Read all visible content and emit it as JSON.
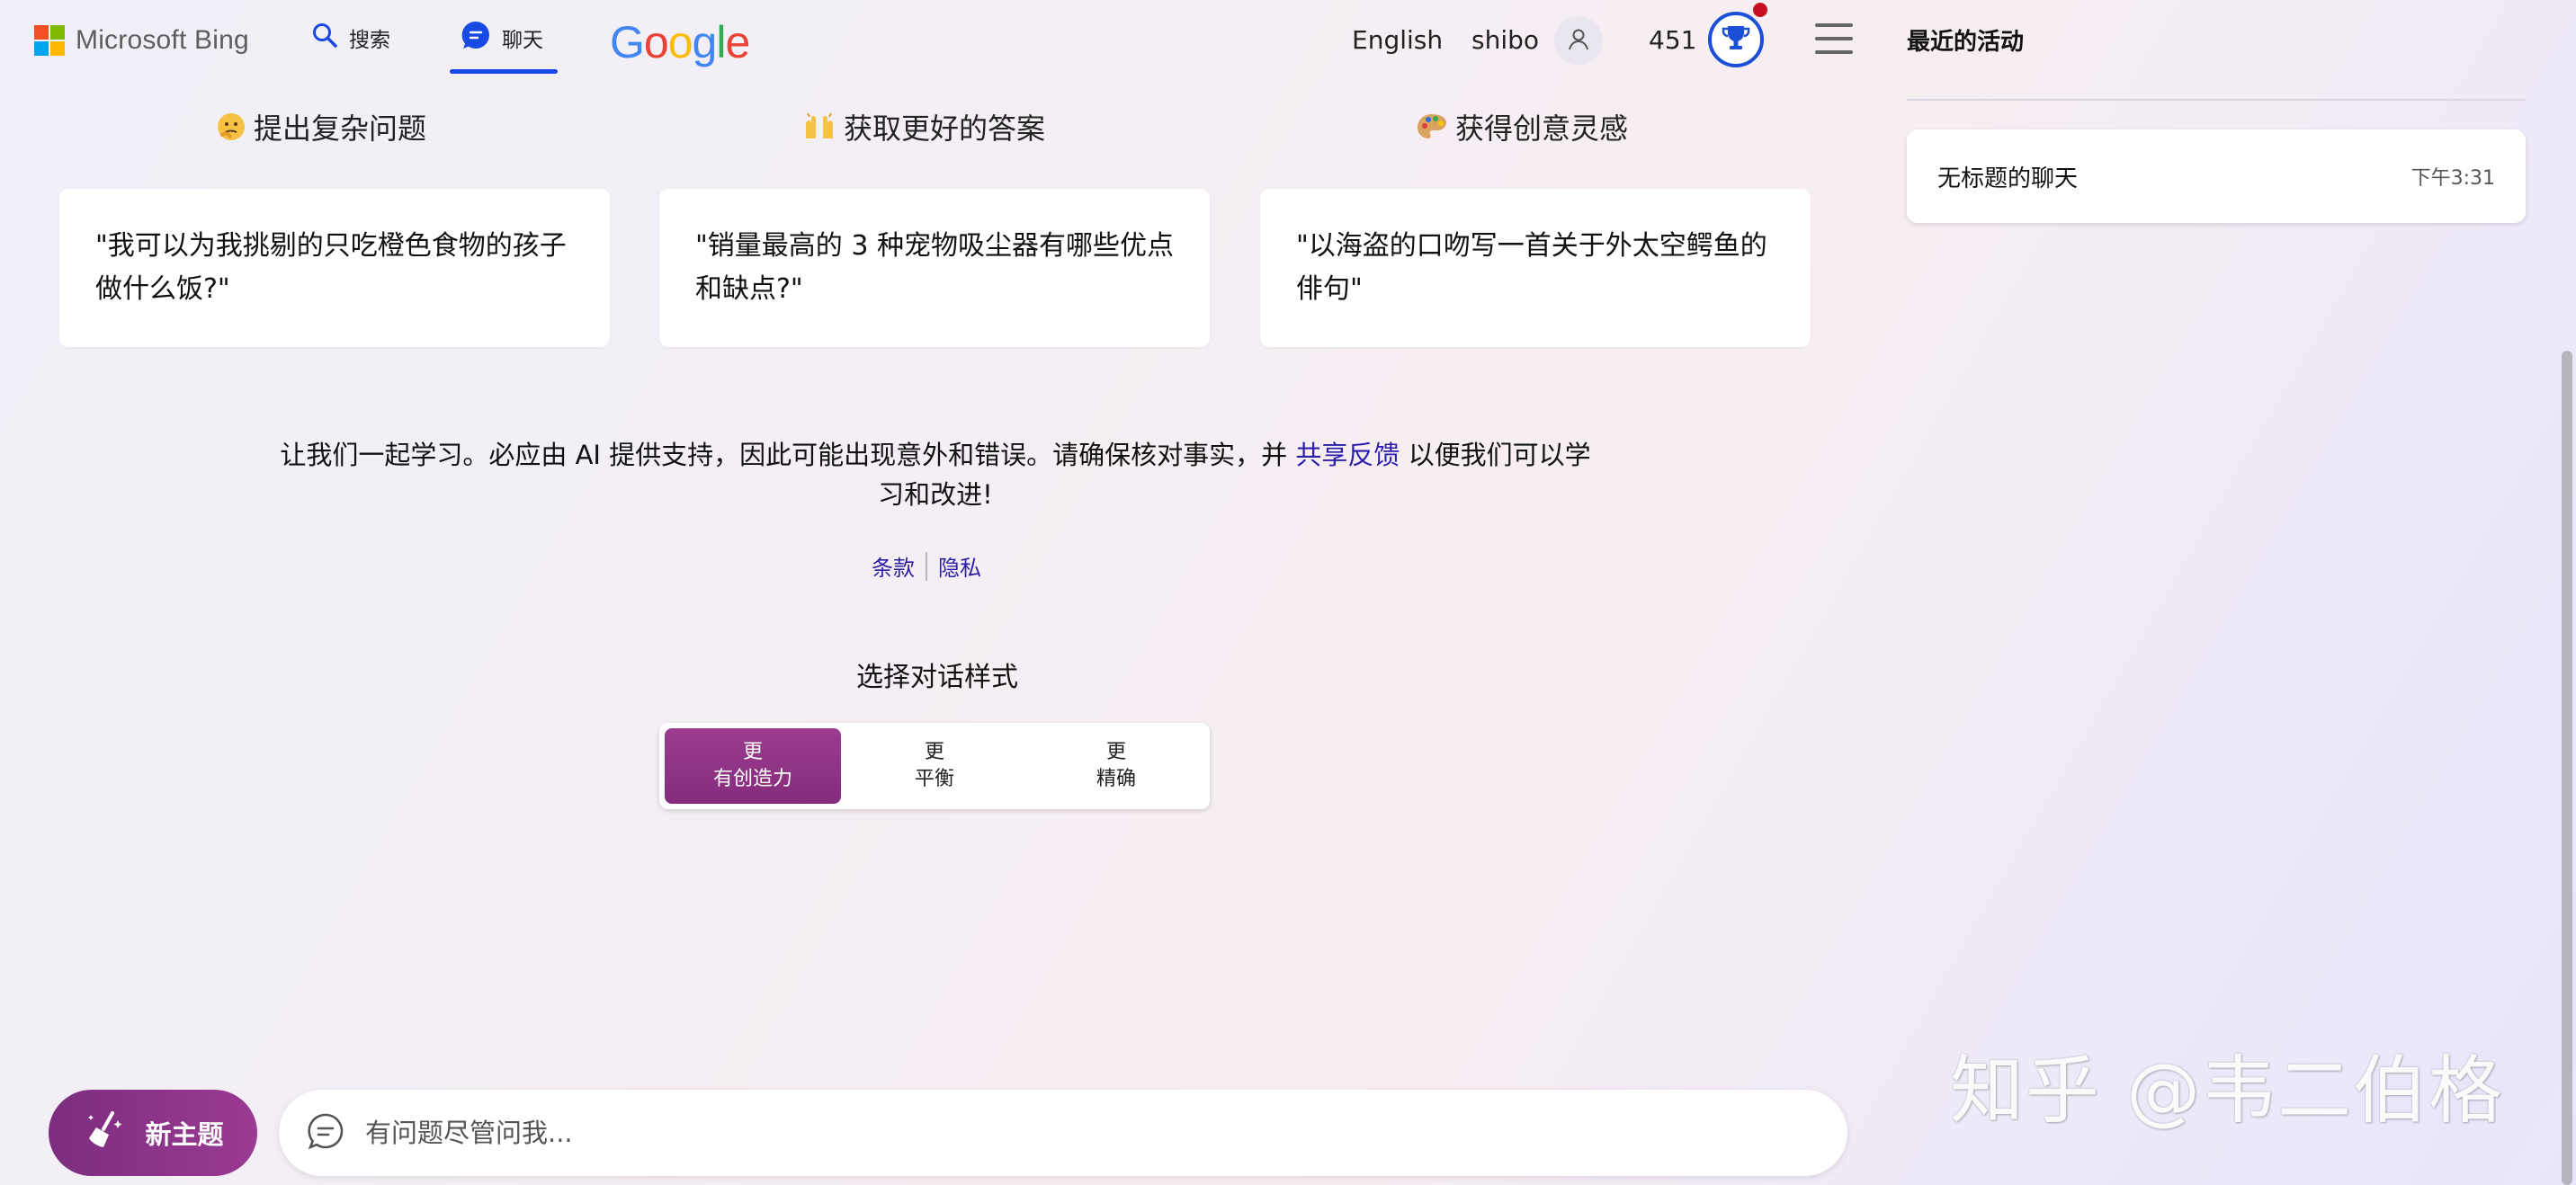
{
  "header": {
    "brand": "Microsoft Bing",
    "nav": {
      "search_label": "搜索",
      "chat_label": "聊天"
    },
    "google_letters": [
      "G",
      "o",
      "o",
      "g",
      "l",
      "e"
    ],
    "language": "English",
    "username": "shibo",
    "points": "451"
  },
  "sidebar": {
    "title": "最近的活动",
    "items": [
      {
        "title": "无标题的聊天",
        "time": "下午3:31"
      }
    ]
  },
  "suggestions": [
    {
      "heading": "提出复杂问题",
      "icon": "thinking-face-emoji",
      "text": "\"我可以为我挑剔的只吃橙色食物的孩子做什么饭?\""
    },
    {
      "heading": "获取更好的答案",
      "icon": "raising-hands-emoji",
      "text": "\"销量最高的 3 种宠物吸尘器有哪些优点和缺点?\""
    },
    {
      "heading": "获得创意灵感",
      "icon": "artist-palette-emoji",
      "text": "\"以海盗的口吻写一首关于外太空鳄鱼的俳句\""
    }
  ],
  "disclaimer": {
    "before": "让我们一起学习。必应由 AI 提供支持，因此可能出现意外和错误。请确保核对事实，并",
    "link": "共享反馈",
    "after": "以便我们可以学习和改进!"
  },
  "legal_links": {
    "terms": "条款",
    "privacy": "隐私"
  },
  "conversation_style": {
    "title": "选择对话样式",
    "options": [
      {
        "line1": "更",
        "line2": "有创造力",
        "selected": true
      },
      {
        "line1": "更",
        "line2": "平衡",
        "selected": false
      },
      {
        "line1": "更",
        "line2": "精确",
        "selected": false
      }
    ]
  },
  "bottom_bar": {
    "new_topic_label": "新主题",
    "input_placeholder": "有问题尽管问我..."
  },
  "watermark": "知乎 @韦二伯格",
  "colors": {
    "accent_blue": "#174ae4",
    "link": "#2b1ea8",
    "creative_purple": "#852c7d",
    "notification_red": "#c50f1f"
  }
}
